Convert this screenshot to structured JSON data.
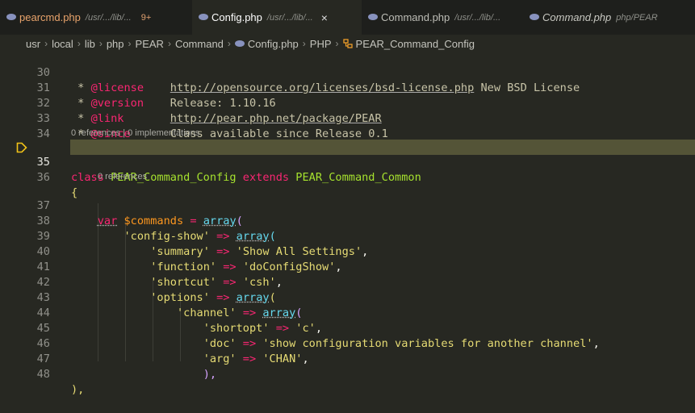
{
  "tabs": [
    {
      "name": "pearcmd.php",
      "path": "/usr/.../lib/...",
      "badge": "9+"
    },
    {
      "name": "Config.php",
      "path": "/usr/.../lib/...",
      "close": "×"
    },
    {
      "name": "Command.php",
      "path": "/usr/.../lib/..."
    },
    {
      "name": "Command.php",
      "path": "php/PEAR"
    }
  ],
  "breadcrumb": [
    "usr",
    "local",
    "lib",
    "php",
    "PEAR",
    "Command",
    "Config.php",
    "PHP",
    "PEAR_Command_Config"
  ],
  "gutter": [
    "30",
    "31",
    "32",
    "33",
    "34",
    "35",
    "36",
    "37",
    "38",
    "39",
    "40",
    "41",
    "42",
    "43",
    "44",
    "45",
    "46",
    "47",
    "48"
  ],
  "lens": {
    "class": "0 references | 0 implementations",
    "prop": "0 references"
  },
  "code": {
    "l30": {
      "star": " * ",
      "tag": "@license",
      "sp": "    ",
      "url": "http://opensource.org/licenses/bsd-license.php",
      "rest": " New BSD License"
    },
    "l31": {
      "star": " * ",
      "tag": "@version",
      "sp": "    ",
      "rest": "Release: 1.10.16"
    },
    "l32": {
      "star": " * ",
      "tag": "@link",
      "sp": "       ",
      "url": "http://pear.php.net/package/PEAR"
    },
    "l33": {
      "star": " * ",
      "tag": "@since",
      "sp": "      ",
      "rest": "Class available since Release 0.1"
    },
    "l34": {
      "end": "*/"
    },
    "l35": {
      "kw": "class",
      "name": "PEAR_Command_Config",
      "ext": "extends",
      "parent": "PEAR_Command_Common"
    },
    "l36": {
      "brace": "{"
    },
    "l37": {
      "kw": "var",
      "var": "$commands",
      "eq": "=",
      "fn": "array",
      "paren": "("
    },
    "l38": {
      "key": "'config-show'",
      "arrow": "=>",
      "fn": "array",
      "paren": "("
    },
    "l39": {
      "key": "'summary'",
      "arrow": "=>",
      "val": "'Show All Settings'",
      "comma": ","
    },
    "l40": {
      "key": "'function'",
      "arrow": "=>",
      "val": "'doConfigShow'",
      "comma": ","
    },
    "l41": {
      "key": "'shortcut'",
      "arrow": "=>",
      "val": "'csh'",
      "comma": ","
    },
    "l42": {
      "key": "'options'",
      "arrow": "=>",
      "fn": "array",
      "paren": "("
    },
    "l43": {
      "key": "'channel'",
      "arrow": "=>",
      "fn": "array",
      "paren": "("
    },
    "l44": {
      "key": "'shortopt'",
      "arrow": "=>",
      "val": "'c'",
      "comma": ","
    },
    "l45": {
      "key": "'doc'",
      "arrow": "=>",
      "val": "'show configuration variables for another channel'",
      "comma": ","
    },
    "l46": {
      "key": "'arg'",
      "arrow": "=>",
      "val": "'CHAN'",
      "comma": ","
    },
    "l47": {
      "close": "),"
    },
    "l48": {
      "close": "),"
    }
  },
  "colors": {
    "highlight": "#545437",
    "accent": "#e6db74"
  }
}
